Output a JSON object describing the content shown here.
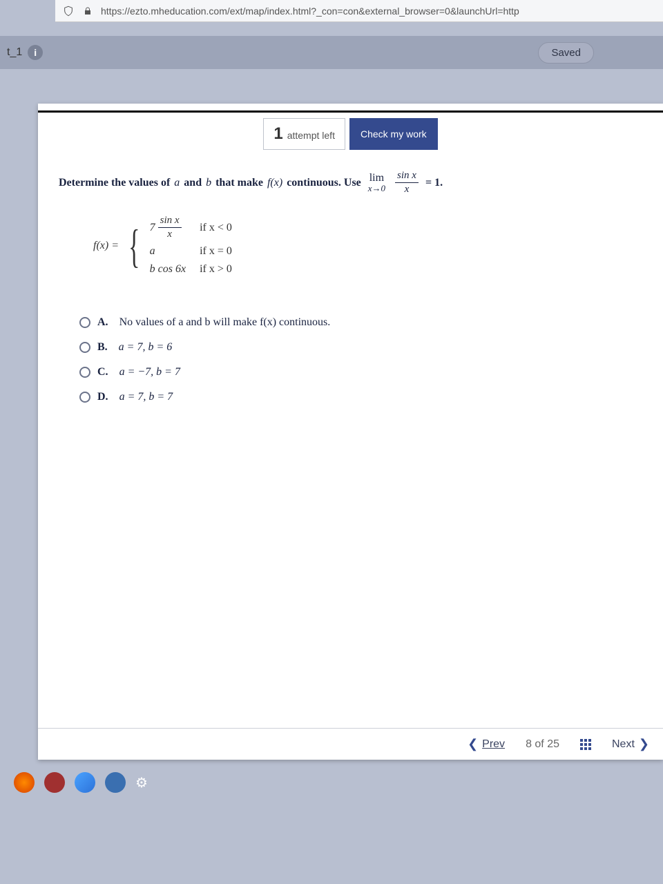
{
  "browser": {
    "url": "https://ezto.mheducation.com/ext/map/index.html?_con=con&external_browser=0&launchUrl=http"
  },
  "tab": {
    "label": "t_1",
    "info": "i",
    "saved": "Saved"
  },
  "toolbar": {
    "attempts_num": "1",
    "attempts_text": "attempt left",
    "check_label": "Check my work"
  },
  "question": {
    "prompt_lead": "Determine the values of",
    "a": "a",
    "and": "and",
    "b": "b",
    "prompt_mid": "that make",
    "fx": "f(x)",
    "prompt_cont": "continuous. Use",
    "lim": "lim",
    "lim_sub": "x→0",
    "frac_num": "sin x",
    "frac_den": "x",
    "eq": "= 1."
  },
  "piecewise": {
    "lhs": "f(x) =",
    "case1_coeff": "7",
    "case1_num": "sin x",
    "case1_den": "x",
    "case1_cond": "if x < 0",
    "case2_expr": "a",
    "case2_cond": "if x = 0",
    "case3_expr": "b cos 6x",
    "case3_cond": "if x > 0"
  },
  "choices": [
    {
      "letter": "A.",
      "text": "No values of a and b will make f(x) continuous.",
      "italic": false
    },
    {
      "letter": "B.",
      "text": "a = 7, b = 6",
      "italic": true
    },
    {
      "letter": "C.",
      "text": "a = −7, b = 7",
      "italic": true
    },
    {
      "letter": "D.",
      "text": "a = 7, b = 7",
      "italic": true
    }
  ],
  "nav": {
    "prev": "Prev",
    "pager": "8 of 25",
    "next": "Next"
  }
}
